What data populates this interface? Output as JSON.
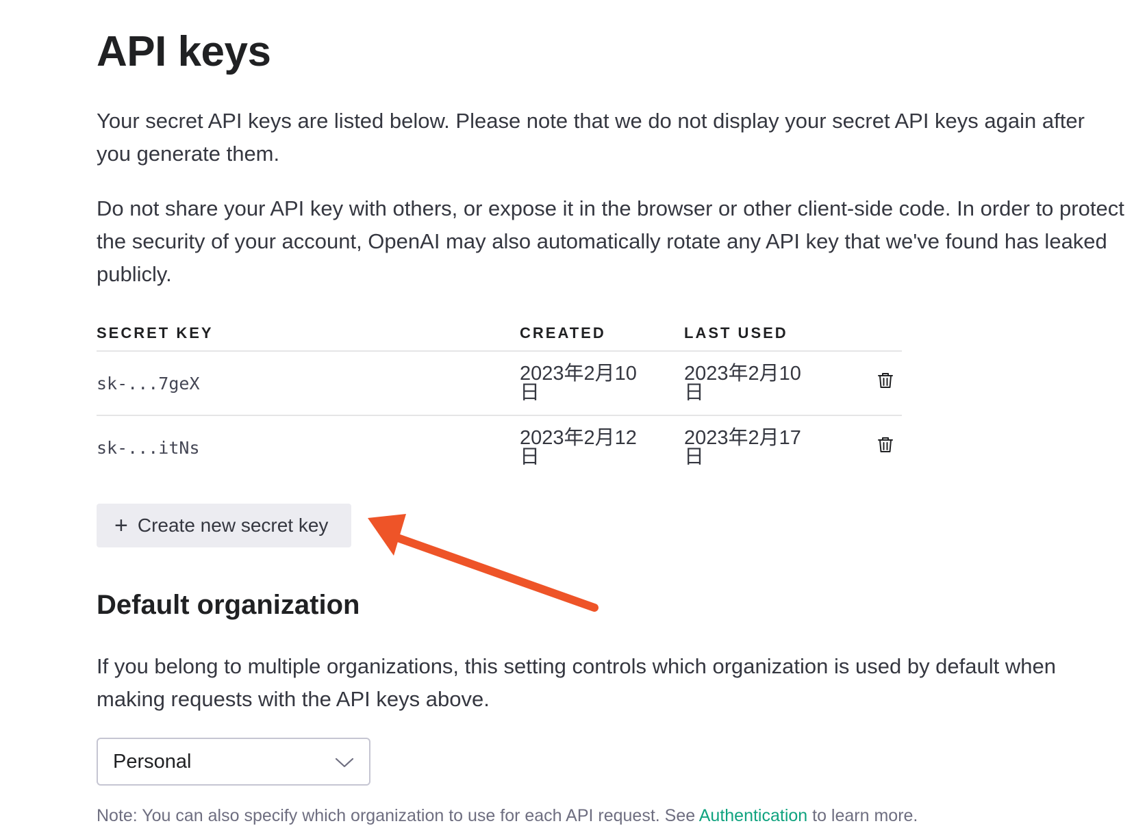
{
  "page": {
    "title": "API keys",
    "intro_1": "Your secret API keys are listed below. Please note that we do not display your secret API keys again after you generate them.",
    "intro_2": "Do not share your API key with others, or expose it in the browser or other client-side code. In order to protect the security of your account, OpenAI may also automatically rotate any API key that we've found has leaked publicly."
  },
  "keys_table": {
    "headers": {
      "secret_key": "SECRET KEY",
      "created": "CREATED",
      "last_used": "LAST USED"
    },
    "rows": [
      {
        "key": "sk-...7geX",
        "created": "2023年2月10日",
        "last_used": "2023年2月10日",
        "action_icon": "trash-icon"
      },
      {
        "key": "sk-...itNs",
        "created": "2023年2月12日",
        "last_used": "2023年2月17日",
        "action_icon": "trash-icon"
      }
    ]
  },
  "create_button": {
    "icon": "plus-icon",
    "label": "Create new secret key"
  },
  "default_org": {
    "title": "Default organization",
    "description": "If you belong to multiple organizations, this setting controls which organization is used by default when making requests with the API keys above.",
    "selected": "Personal",
    "dropdown_icon": "chevron-down-icon",
    "note_prefix": "Note: You can also specify which organization to use for each API request. See ",
    "note_link": "Authentication",
    "note_suffix": " to learn more."
  },
  "colors": {
    "accent_link": "#10a37f",
    "annotation_arrow": "#ee5428",
    "button_bg": "#ececf1"
  }
}
